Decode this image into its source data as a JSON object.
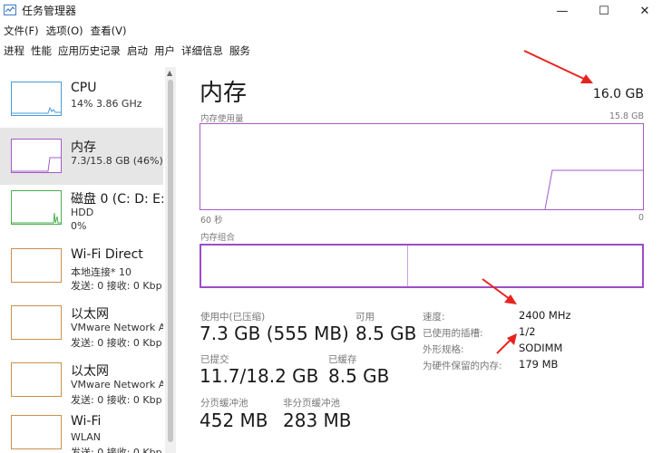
{
  "window": {
    "title": "任务管理器",
    "minimize": "—",
    "maximize": "☐",
    "close": "✕"
  },
  "menu": [
    "文件(F)",
    "选项(O)",
    "查看(V)"
  ],
  "tabs": [
    "进程",
    "性能",
    "应用历史记录",
    "启动",
    "用户",
    "详细信息",
    "服务"
  ],
  "sidebar": {
    "items": [
      {
        "name": "CPU",
        "line1": "14%  3.86 GHz",
        "line2": "",
        "color": "#4a9bd6"
      },
      {
        "name": "内存",
        "line1": "7.3/15.8 GB (46%)",
        "line2": "",
        "color": "#a45bc7"
      },
      {
        "name": "磁盘 0 (C: D: E:",
        "line1": "HDD",
        "line2": "0%",
        "color": "#4caf50"
      },
      {
        "name": "Wi-Fi Direct",
        "line1": "本地连接* 10",
        "line2": "发送: 0 接收: 0 Kbp",
        "color": "#c9904f"
      },
      {
        "name": "以太网",
        "line1": "VMware Network A",
        "line2": "发送: 0 接收: 0 Kbp",
        "color": "#c9904f"
      },
      {
        "name": "以太网",
        "line1": "VMware Network A",
        "line2": "发送: 0 接收: 0 Kbp",
        "color": "#c9904f"
      },
      {
        "name": "Wi-Fi",
        "line1": "WLAN",
        "line2": "发送: 0 接收: 0 Kbp",
        "color": "#c9904f"
      }
    ]
  },
  "memory": {
    "title": "内存",
    "total": "16.0 GB",
    "usage_label": "内存使用量",
    "usage_max": "15.8 GB",
    "time_left": "60 秒",
    "time_right": "0",
    "composition_label": "内存组合",
    "in_use_label": "使用中(已压缩)",
    "in_use_value": "7.3 GB (555 MB)",
    "available_label": "可用",
    "available_value": "8.5 GB",
    "committed_label": "已提交",
    "committed_value": "11.7/18.2 GB",
    "cached_label": "已缓存",
    "cached_value": "8.5 GB",
    "paged_label": "分页缓冲池",
    "paged_value": "452 MB",
    "nonpaged_label": "非分页缓冲池",
    "nonpaged_value": "283 MB",
    "speed_label": "速度:",
    "speed_value": "2400 MHz",
    "slots_label": "已使用的插槽:",
    "slots_value": "1/2",
    "form_label": "外形规格:",
    "form_value": "SODIMM",
    "reserved_label": "为硬件保留的内存:",
    "reserved_value": "179 MB",
    "accent": "#a45bc7"
  },
  "annotation_color": "#e8231f"
}
